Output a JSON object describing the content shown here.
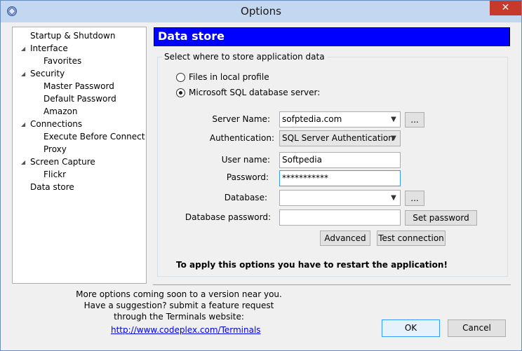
{
  "window": {
    "title": "Options",
    "close_glyph": "✕"
  },
  "tree": {
    "items": [
      {
        "label": "Startup & Shutdown"
      },
      {
        "label": "Interface"
      },
      {
        "label": "Favorites"
      },
      {
        "label": "Security"
      },
      {
        "label": "Master Password"
      },
      {
        "label": "Default Password"
      },
      {
        "label": "Amazon"
      },
      {
        "label": "Connections"
      },
      {
        "label": "Execute Before Connect"
      },
      {
        "label": "Proxy"
      },
      {
        "label": "Screen Capture"
      },
      {
        "label": "Flickr"
      },
      {
        "label": "Data store"
      }
    ]
  },
  "panel": {
    "header": "Data store",
    "group_title": "Select where to store application data",
    "radio_local_label": "Files in local profile",
    "radio_sql_label": "Microsoft SQL database server:",
    "server_name_label": "Server Name:",
    "server_name_value": "sofptedia.com",
    "server_browse_label": "...",
    "auth_label": "Authentication:",
    "auth_value": "SQL Server Authentication",
    "user_label": "User name:",
    "user_value": "Softpedia",
    "password_label": "Password:",
    "password_value": "***********",
    "database_label": "Database:",
    "database_value": "",
    "database_browse_label": "...",
    "db_password_label": "Database password:",
    "db_password_value": "",
    "set_password_label": "Set password",
    "advanced_label": "Advanced",
    "test_connection_label": "Test connection",
    "restart_note": "To apply this options you have to restart the application!"
  },
  "footer": {
    "line1": "More options coming soon to a version near you.",
    "line2": "Have a suggestion? submit a feature request",
    "line3": "through the Terminals website:",
    "link": "http://www.codeplex.com/Terminals",
    "ok_label": "OK",
    "cancel_label": "Cancel"
  }
}
